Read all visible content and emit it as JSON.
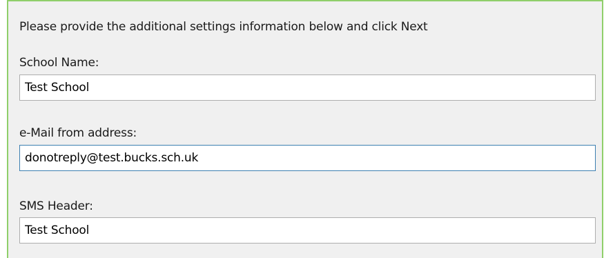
{
  "form": {
    "instructions": "Please provide the additional settings information below and click Next",
    "school_name": {
      "label": "School Name:",
      "value": "Test School"
    },
    "email_from": {
      "label": "e-Mail from address:",
      "value": "donotreply@test.bucks.sch.uk"
    },
    "sms_header": {
      "label": "SMS Header:",
      "value": "Test School"
    }
  },
  "colors": {
    "panel_border": "#8fcf6a",
    "focused_input_border": "#3c7fb1"
  }
}
